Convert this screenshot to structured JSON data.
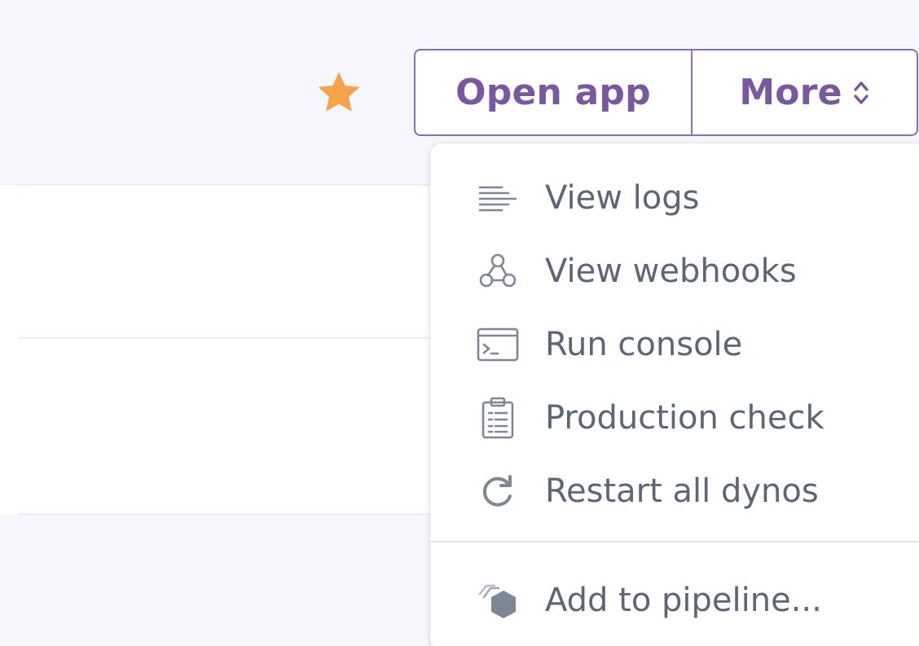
{
  "colors": {
    "accent": "#79589f",
    "star": "#f6a34b",
    "menu_text": "#5c6675",
    "icon": "#7e8795",
    "background": "#f5f7fc"
  },
  "header": {
    "favorite_icon": "star-icon",
    "open_app_label": "Open app",
    "more_label": "More",
    "more_icon": "chevron-up-down-icon"
  },
  "menu": {
    "items": [
      {
        "label": "View logs",
        "icon": "logs-icon"
      },
      {
        "label": "View webhooks",
        "icon": "webhooks-icon"
      },
      {
        "label": "Run console",
        "icon": "console-icon"
      },
      {
        "label": "Production check",
        "icon": "clipboard-icon"
      },
      {
        "label": "Restart all dynos",
        "icon": "restart-icon"
      },
      {
        "label": "Add to pipeline...",
        "icon": "pipeline-icon"
      }
    ]
  }
}
